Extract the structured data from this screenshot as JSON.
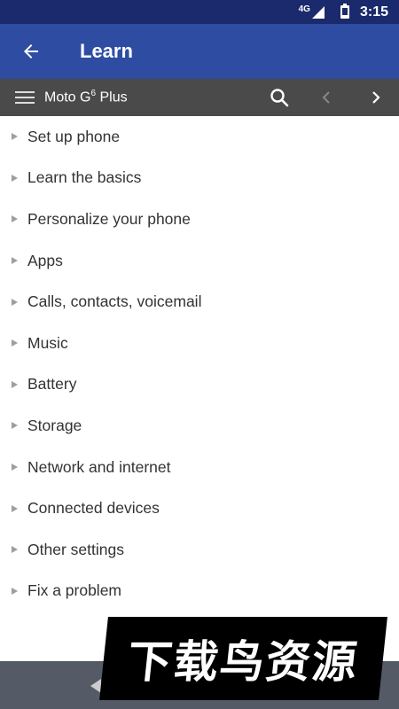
{
  "status_bar": {
    "network": "4G",
    "time": "3:15"
  },
  "app_bar": {
    "title": "Learn",
    "back_icon": "arrow-back-icon"
  },
  "toolbar": {
    "device_name_base": "Moto G",
    "device_name_sup": "6",
    "device_name_suffix": " Plus",
    "menu_icon": "hamburger-menu-icon",
    "search_icon": "search-icon",
    "prev_icon": "chevron-left-icon",
    "next_icon": "chevron-right-icon"
  },
  "topics": [
    "Set up phone",
    "Learn the basics",
    "Personalize your phone",
    "Apps",
    "Calls, contacts, voicemail",
    "Music",
    "Battery",
    "Storage",
    "Network and internet",
    "Connected devices",
    "Other settings",
    "Fix a problem"
  ],
  "watermark": {
    "text": "下载鸟资源"
  },
  "colors": {
    "status_bar": "#1a2a6c",
    "app_bar": "#2f4ca3",
    "toolbar": "#4a4a4a",
    "bottom_bar": "#555b66"
  }
}
